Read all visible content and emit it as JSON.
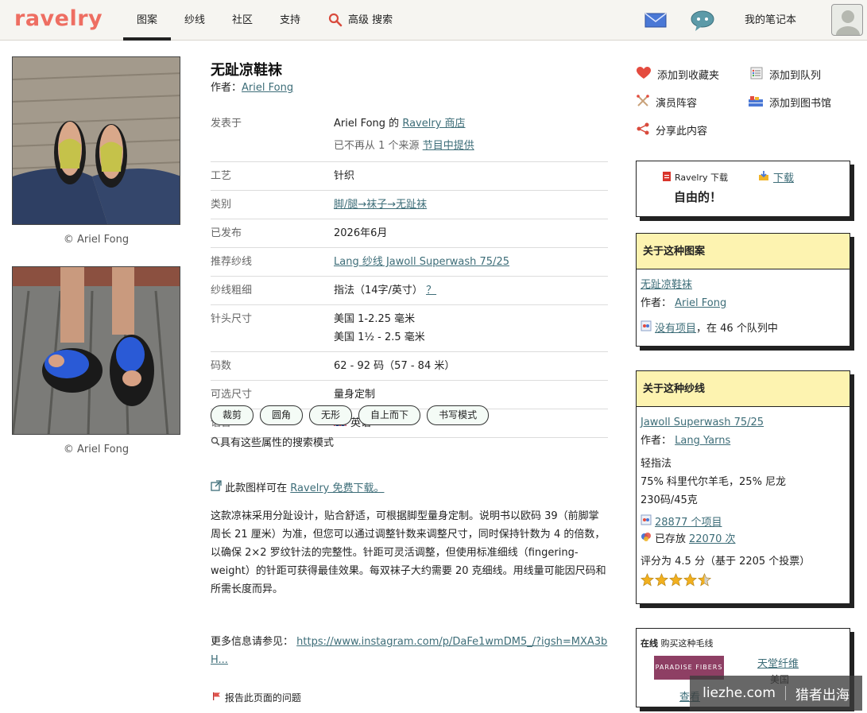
{
  "nav": {
    "logo": "ravelry",
    "items": [
      "图案",
      "纱线",
      "社区",
      "支持"
    ],
    "search_label": "高级 搜索",
    "notebook": "我的笔记本"
  },
  "photos": {
    "caption1": "© Ariel Fong",
    "caption2": "© Ariel Fong"
  },
  "pattern": {
    "title": "无趾凉鞋袜",
    "author_prefix": "作者：",
    "author": "Ariel Fong"
  },
  "details": {
    "published_in_label": "发表于",
    "published_in_author": "Ariel Fong 的",
    "published_in_shop": "Ravelry 商店",
    "source_note": "已不再从 1 个来源",
    "source_link": "节目中提供",
    "craft_label": "工艺",
    "craft": "针织",
    "category_label": "类别",
    "category": "脚/腿→袜子→无趾袜",
    "published_label": "已发布",
    "published": "2026年6月",
    "yarn_label": "推荐纱线",
    "yarn": "Lang 纱线 Jawoll Superwash 75/25",
    "weight_label": "纱线粗细",
    "weight": "指法（14字/英寸）",
    "weight_help": "？",
    "needle_label": "针头尺寸",
    "needle1": "美国 1-2.25 毫米",
    "needle2": "美国 1½ - 2.5 毫米",
    "yardage_label": "码数",
    "yardage": "62 - 92 码（57 - 84 米）",
    "sizes_label": "可选尺寸",
    "sizes": "量身定制",
    "language_label": "语言",
    "language": "英语"
  },
  "tags": [
    "裁剪",
    "圆角",
    "无形",
    "自上而下",
    "书写模式"
  ],
  "tag_search": "具有这些属性的搜索模式",
  "free_download": {
    "prefix": "此款图样可在",
    "link": "Ravelry 免费下载。"
  },
  "description": "这款凉袜采用分趾设计，贴合舒适，可根据脚型量身定制。说明书以欧码 39（前脚掌周长 21 厘米）为准，但您可以通过调整针数来调整尺寸，同时保持针数为 4 的倍数，以确保 2×2 罗纹针法的完整性。针距可灵活调整，但使用标准细线（fingering-weight）的针距可获得最佳效果。每双袜子大约需要 20 克细线。用线量可能因尺码和所需长度而异。",
  "more_info": {
    "prefix": "更多信息请参见：",
    "link": "https://www.instagram.com/p/DaFe1wmDM5_/?igsh=MXA3bH..."
  },
  "report": "报告此页面的问题",
  "actions": {
    "favorite": "添加到收藏夹",
    "queue": "添加到队列",
    "cast": "演员阵容",
    "library": "添加到图书馆",
    "share": "分享此内容"
  },
  "download_box": {
    "ravelry_download": "Ravelry 下载",
    "download": "下载",
    "free": "自由的！"
  },
  "about_pattern": {
    "header": "关于这种图案",
    "name": "无趾凉鞋袜",
    "author_prefix": "作者：",
    "author": "Ariel Fong",
    "projects_link": "没有项目",
    "queue_text": "，在 46 个队列中"
  },
  "about_yarn": {
    "header": "关于这种纱线",
    "name": "Jawoll Superwash 75/25",
    "author_prefix": "作者：",
    "brand": "Lang Yarns",
    "weight": "轻指法",
    "fiber": "75% 科里代尔羊毛，25% 尼龙",
    "yardage": "230码/45克",
    "projects_link": "28877 个项目",
    "stash_prefix": "已存放",
    "stash_link": "22070 次",
    "rating": "评分为 4.5 分（基于 2205 个投票）",
    "rating_value": 4.5
  },
  "buy_box": {
    "online": "在线",
    "title": "购买这种毛线",
    "shop_logo": "PARADISE FIBERS",
    "shop": "天堂纤维",
    "country": "美国",
    "view": "查看"
  },
  "watermark": {
    "site": "liezhe.com",
    "brand": "猎者出海"
  }
}
